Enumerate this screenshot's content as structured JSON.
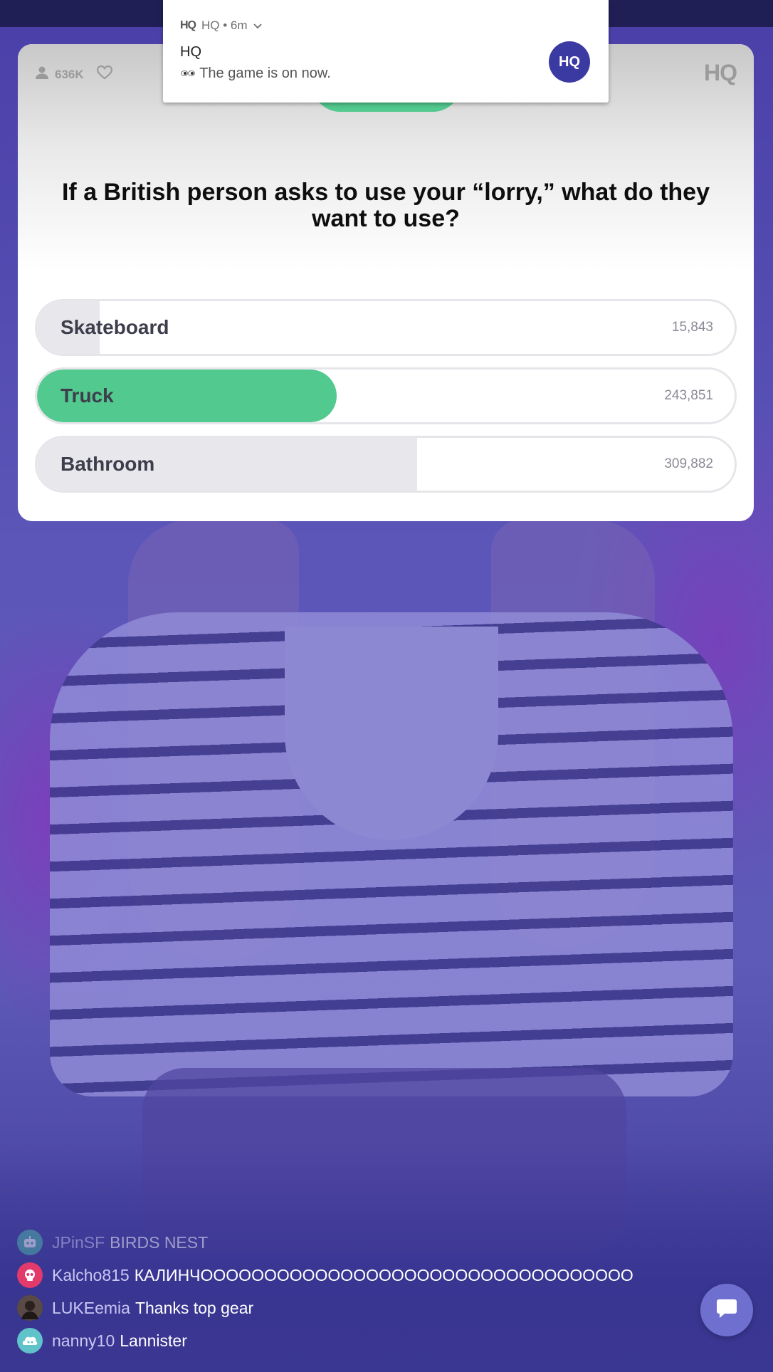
{
  "status": {
    "viewer_count": "636K"
  },
  "brand": {
    "logo": "HQ"
  },
  "notification": {
    "app_name": "HQ",
    "time": "HQ • 6m",
    "title": "HQ",
    "body": "The game is on now.",
    "icon_text": "HQ"
  },
  "question": {
    "text": "If a British person asks to use your “lorry,” what do they want to use?",
    "answers": [
      {
        "label": "Skateboard",
        "count": "15,843",
        "fraction": 0.09,
        "correct": false
      },
      {
        "label": "Truck",
        "count": "243,851",
        "fraction": 0.43,
        "correct": true
      },
      {
        "label": "Bathroom",
        "count": "309,882",
        "fraction": 0.545,
        "correct": false
      }
    ]
  },
  "chat": {
    "messages": [
      {
        "user": "JPinSF",
        "text": "BIRDS NEST",
        "avatar_icon": "robot-icon",
        "avatar_color": "#4fb8a8"
      },
      {
        "user": "Kalcho815",
        "text": "КАЛИНЧOOOOOOOOOOOOOOOOOOOOOOOOOOOOOOOOOO",
        "avatar_icon": "skull-icon",
        "avatar_color": "#e23a6a"
      },
      {
        "user": "LUKEemia",
        "text": "Thanks top gear",
        "avatar_icon": "photo-avatar",
        "avatar_color": "#3a3030"
      },
      {
        "user": "nanny10",
        "text": "Lannister",
        "avatar_icon": "ghost-icon",
        "avatar_color": "#5fc3c9"
      }
    ]
  },
  "colors": {
    "correct": "#52c98e",
    "brand": "#3b3aa2",
    "chat_button": "#6f6fd0"
  }
}
